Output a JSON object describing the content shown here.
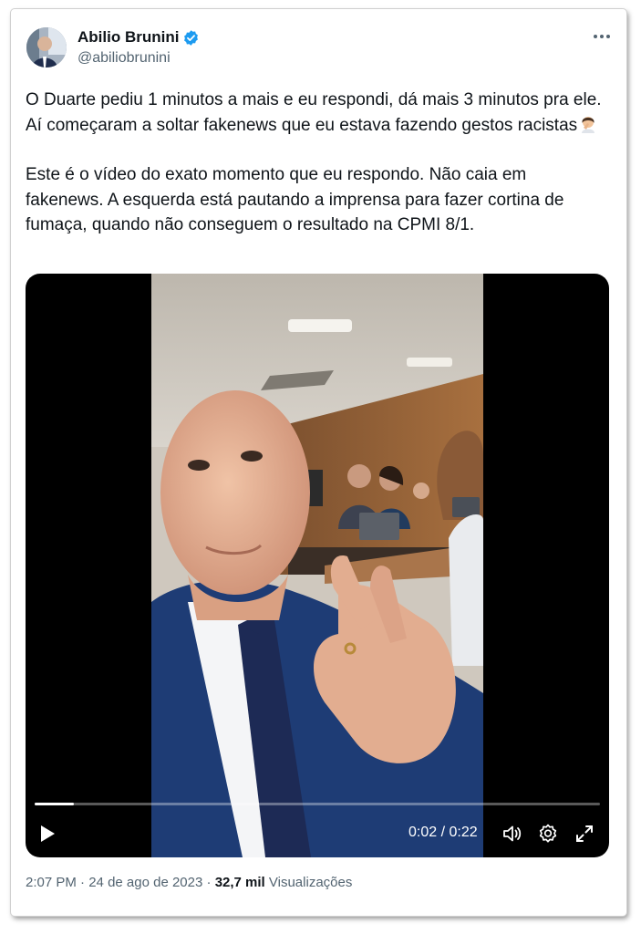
{
  "author": {
    "name": "Abilio Brunini",
    "handle": "@abiliobrunini",
    "verified": true
  },
  "tweet": {
    "paragraph1": "O Duarte pediu 1 minutos a mais e eu respondi, dá mais 3 minutos pra ele. Aí começaram a soltar fakenews que eu estava fazendo gestos racistas",
    "paragraph2": "Este é o vídeo do exato momento que eu respondo. Não caia em fakenews. A esquerda está pautando a imprensa para fazer cortina de fumaça, quando não conseguem o resultado na CPMI 8/1."
  },
  "video": {
    "current_time": "0:02",
    "separator": " / ",
    "duration": "0:22",
    "progress_fraction": 0.07
  },
  "meta": {
    "time": "2:07 PM",
    "sep1": " · ",
    "date": "24 de ago de 2023",
    "sep2": " · ",
    "views_count": "32,7 mil",
    "views_label": " Visualizações"
  },
  "icons": {
    "more": "more-dots-icon",
    "verified": "verified-badge-icon",
    "play": "play-icon",
    "volume": "volume-icon",
    "settings": "gear-icon",
    "fullscreen": "fullscreen-icon"
  },
  "colors": {
    "text": "#0f1419",
    "secondary": "#536471",
    "verified": "#1d9bf0"
  }
}
